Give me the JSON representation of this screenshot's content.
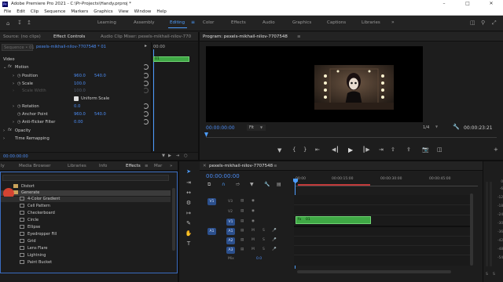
{
  "titlebar": {
    "title": "Adobe Premiere Pro 2021 - C:\\Pr-Projects\\Handy.prproj *",
    "app_icon": "Pr"
  },
  "menubar": [
    "File",
    "Edit",
    "Clip",
    "Sequence",
    "Markers",
    "Graphics",
    "View",
    "Window",
    "Help"
  ],
  "workspaces": [
    "Learning",
    "Assembly",
    "Editing",
    "Color",
    "Effects",
    "Audio",
    "Graphics",
    "Captions",
    "Libraries"
  ],
  "active_workspace": "Editing",
  "source_panel": {
    "tabs": [
      "Source: (no clips)",
      "Effect Controls",
      "Audio Clip Mixer: pexels-mikhail-nilov-770"
    ],
    "active_tab": "Effect Controls",
    "clip_selector": "Sequence • 01",
    "clip_name": "pexels-mikhail-nilov-7707548 * 01",
    "timecode_ruler": "00:00",
    "mini_clip": "01",
    "section_video": "Video",
    "motion": {
      "label": "Motion",
      "position_label": "Position",
      "position_x": "960.0",
      "position_y": "540.0",
      "scale_label": "Scale",
      "scale_val": "100.0",
      "scale_width_label": "Scale Width",
      "scale_width_val": "100.0",
      "uniform_scale": "Uniform Scale",
      "rotation_label": "Rotation",
      "rotation_val": "0.0",
      "anchor_label": "Anchor Point",
      "anchor_x": "960.0",
      "anchor_y": "540.0",
      "antiflicker_label": "Anti-flicker Filter",
      "antiflicker_val": "0.00"
    },
    "opacity_label": "Opacity",
    "time_remap_label": "Time Remapping",
    "timecode": "00:00:00:00"
  },
  "program_panel": {
    "title": "Program: pexels-mikhail-nilov-7707548",
    "timecode": "00:00:00:00",
    "fit_label": "Fit",
    "ratio": "1/4",
    "duration": "00:00:23:21"
  },
  "project_panel": {
    "tabs": [
      "Media Browser",
      "Libraries",
      "Info",
      "Effects",
      "Mar"
    ],
    "active_tab": "Effects",
    "partial_tab": "ly",
    "folder_distort": "Distort",
    "folder_generate": "Generate",
    "effects": [
      "4-Color Gradient",
      "Cell Pattern",
      "Checkerboard",
      "Circle",
      "Ellipse",
      "Eyedropper Fill",
      "Grid",
      "Lens Flare",
      "Lightning",
      "Paint Bucket"
    ]
  },
  "timeline": {
    "tab": "pexels-mikhail-nilov-7707548",
    "timecode": "00:00:00:00",
    "ruler": [
      "00:00",
      "00:00:15:00",
      "00:00:30:00",
      "00:00:45:00"
    ],
    "video_tracks": [
      "V3",
      "V2",
      "V1"
    ],
    "audio_tracks": [
      "A1",
      "A2",
      "A3"
    ],
    "source_patch_v": "V1",
    "source_patch_a": "A1",
    "mix_label": "Mix",
    "mix_value": "0.0",
    "clip_label": "01"
  },
  "audio_meter": {
    "ticks": [
      "0",
      "-6",
      "-12",
      "-18",
      "-24",
      "-30",
      "-36",
      "-42",
      "-48",
      "-54"
    ],
    "bottom": [
      "S",
      "S"
    ]
  },
  "colors": {
    "accent": "#4d9dff",
    "clip_green": "#3fa845",
    "track_blue": "#2b4f8c",
    "value_blue": "#4c8df6"
  }
}
